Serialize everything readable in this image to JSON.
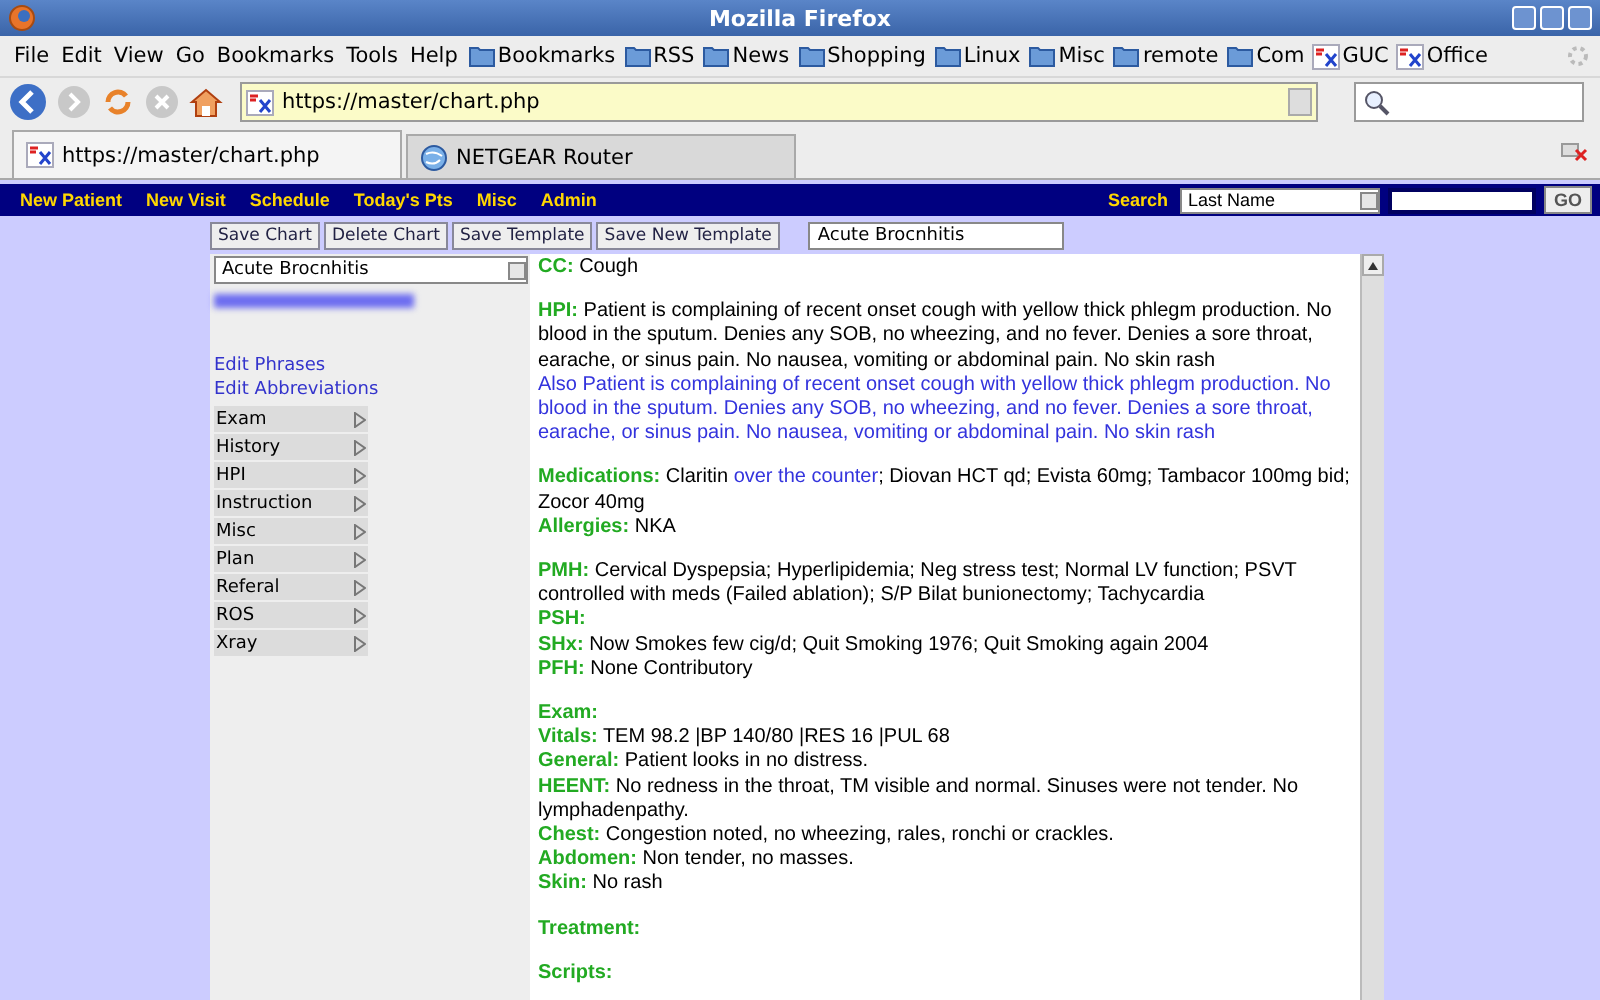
{
  "window": {
    "title": "Mozilla Firefox"
  },
  "menu": [
    "File",
    "Edit",
    "View",
    "Go",
    "Bookmarks",
    "Tools",
    "Help"
  ],
  "bookmarks": [
    {
      "label": "Bookmarks",
      "kind": "folder"
    },
    {
      "label": "RSS",
      "kind": "folder"
    },
    {
      "label": "News",
      "kind": "folder"
    },
    {
      "label": "Shopping",
      "kind": "folder"
    },
    {
      "label": "Linux",
      "kind": "folder"
    },
    {
      "label": "Misc",
      "kind": "folder"
    },
    {
      "label": "remote",
      "kind": "folder"
    },
    {
      "label": "Com",
      "kind": "folder"
    },
    {
      "label": "GUC",
      "kind": "site"
    },
    {
      "label": "Office",
      "kind": "site"
    }
  ],
  "address": {
    "value": "https://master/chart.php"
  },
  "tabs": [
    {
      "label": "https://master/chart.php",
      "selected": true,
      "kind": "site"
    },
    {
      "label": "NETGEAR Router",
      "selected": false,
      "kind": "globe"
    }
  ],
  "app_nav": {
    "items": [
      "New Patient",
      "New Visit",
      "Schedule",
      "Today's Pts",
      "Misc",
      "Admin"
    ],
    "search_label": "Search",
    "search_by": "Last Name",
    "go": "GO"
  },
  "toolbar": {
    "buttons": [
      "Save Chart",
      "Delete Chart",
      "Save Template",
      "Save New Template"
    ],
    "template_name": "Acute Brocnhitis"
  },
  "sidebar": {
    "template": "Acute Brocnhitis",
    "links": [
      "Edit Phrases",
      "Edit Abbreviations"
    ],
    "items": [
      "Exam",
      "History",
      "HPI",
      "Instruction",
      "Misc",
      "Plan",
      "Referal",
      "ROS",
      "Xray"
    ]
  },
  "chart": [
    [
      {
        "label": "CC:",
        "parts": [
          {
            "text": "Cough",
            "added": false
          }
        ]
      }
    ],
    [
      {
        "label": "HPI:",
        "parts": [
          {
            "text": "Patient is complaining of recent onset cough with yellow thick phlegm production. No blood in the sputum. Denies any SOB, no wheezing, and no fever. Denies a sore throat, earache, or sinus pain. No nausea, vomiting or abdominal pain. No skin rash",
            "added": false
          }
        ]
      },
      {
        "parts": [
          {
            "text": "Also Patient is complaining of recent onset cough with yellow thick phlegm production. No blood in the sputum. Denies any SOB, no wheezing, and no fever. Denies a sore throat, earache, or sinus pain. No nausea, vomiting or abdominal pain. No skin rash",
            "added": true
          }
        ]
      }
    ],
    [
      {
        "label": "Medications:",
        "parts": [
          {
            "text": "Claritin ",
            "added": false
          },
          {
            "text": "over the counter",
            "added": true
          },
          {
            "text": "; Diovan HCT qd; Evista 60mg; Tambacor 100mg bid; Zocor 40mg",
            "added": false
          }
        ]
      },
      {
        "label": "Allergies:",
        "parts": [
          {
            "text": "NKA",
            "added": false
          }
        ]
      }
    ],
    [
      {
        "label": "PMH:",
        "parts": [
          {
            "text": "Cervical Dyspepsia; Hyperlipidemia; Neg stress test; Normal LV function; PSVT controlled with meds (Failed ablation); S/P Bilat bunionectomy; Tachycardia",
            "added": false
          }
        ]
      },
      {
        "label": "PSH:"
      },
      {
        "label": "SHx:",
        "parts": [
          {
            "text": "Now Smokes few cig/d; Quit Smoking 1976; Quit Smoking again 2004",
            "added": false
          }
        ]
      },
      {
        "label": "PFH:",
        "parts": [
          {
            "text": "None Contributory",
            "added": false
          }
        ]
      }
    ],
    [
      {
        "label": "Exam:"
      },
      {
        "label": "Vitals:",
        "parts": [
          {
            "text": "TEM 98.2 |BP 140/80 |RES 16 |PUL 68",
            "added": false
          }
        ]
      },
      {
        "label": "General:",
        "parts": [
          {
            "text": "Patient looks in no distress.",
            "added": false
          }
        ]
      },
      {
        "label": "HEENT:",
        "parts": [
          {
            "text": "No redness in the throat, TM visible and normal. Sinuses were not tender. No lymphadenpathy.",
            "added": false
          }
        ]
      },
      {
        "label": "Chest:",
        "parts": [
          {
            "text": "Congestion noted, no wheezing, rales, ronchi or crackles.",
            "added": false
          }
        ]
      },
      {
        "label": "Abdomen:",
        "parts": [
          {
            "text": "Non tender, no masses.",
            "added": false
          }
        ]
      },
      {
        "label": "Skin:",
        "parts": [
          {
            "text": "No rash",
            "added": false
          }
        ]
      }
    ],
    [
      {
        "label": "Treatment:"
      }
    ],
    [
      {
        "label": "Scripts:"
      }
    ]
  ]
}
